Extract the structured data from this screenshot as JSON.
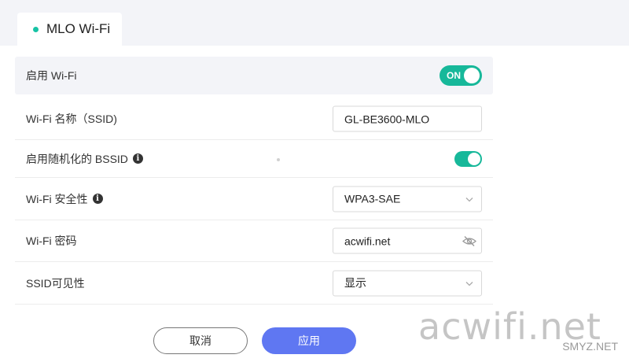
{
  "tab": {
    "label": "MLO Wi-Fi"
  },
  "rows": {
    "enable_wifi": {
      "label": "启用 Wi-Fi",
      "toggle_text": "ON"
    },
    "ssid": {
      "label": "Wi-Fi 名称（SSID)",
      "value": "GL-BE3600-MLO"
    },
    "random_bssid": {
      "label": "启用随机化的 BSSID"
    },
    "security": {
      "label": "Wi-Fi 安全性",
      "value": "WPA3-SAE"
    },
    "password": {
      "label": "Wi-Fi 密码",
      "value": "acwifi.net"
    },
    "ssid_visibility": {
      "label": "SSID可见性",
      "value": "显示"
    }
  },
  "buttons": {
    "cancel": "取消",
    "apply": "应用"
  },
  "watermark": {
    "main": "acwifi.net",
    "secondary": "SMYZ.NET"
  },
  "icons": {
    "info": "info-icon",
    "chevron": "chevron-down-icon",
    "eye": "eye-off-icon"
  },
  "colors": {
    "accent": "#17b89a",
    "primary_button": "#5f77f2",
    "tab_dot": "#17c3a5"
  }
}
